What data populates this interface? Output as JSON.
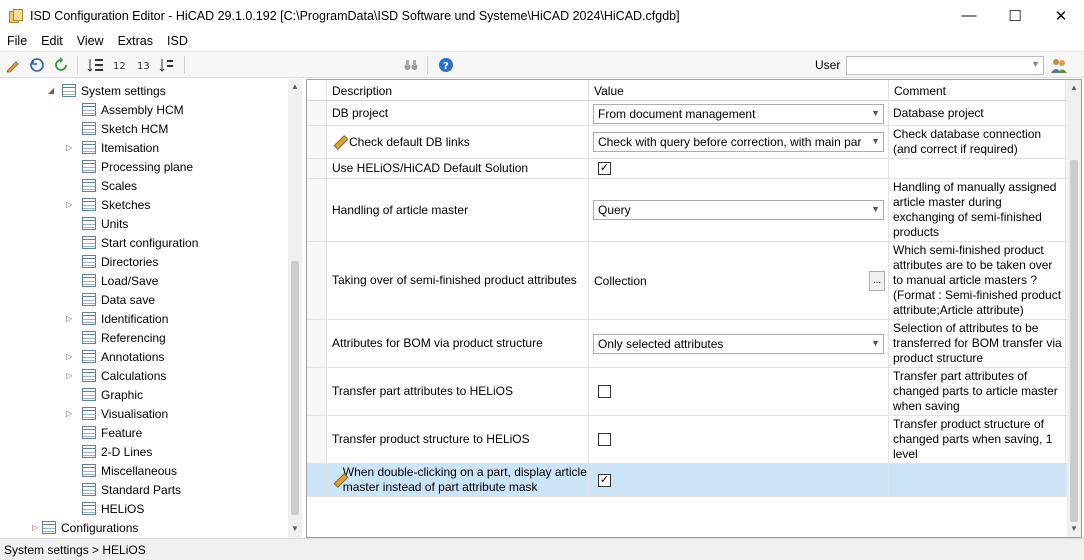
{
  "window": {
    "title": "ISD Configuration Editor  -  HiCAD 29.1.0.192 [C:\\ProgramData\\ISD Software und Systeme\\HiCAD 2024\\HiCAD.cfgdb]",
    "minimize": "—",
    "maximize": "☐",
    "close": "✕"
  },
  "menu": [
    "File",
    "Edit",
    "View",
    "Extras",
    "ISD"
  ],
  "toolbar": {
    "user_label": "User",
    "user_value": ""
  },
  "tree": {
    "root": "System settings",
    "items": [
      {
        "label": "Assembly HCM",
        "expandable": false
      },
      {
        "label": "Sketch HCM",
        "expandable": false
      },
      {
        "label": "Itemisation",
        "expandable": true
      },
      {
        "label": "Processing plane",
        "expandable": false
      },
      {
        "label": "Scales",
        "expandable": false
      },
      {
        "label": "Sketches",
        "expandable": true
      },
      {
        "label": "Units",
        "expandable": false
      },
      {
        "label": "Start configuration",
        "expandable": false
      },
      {
        "label": "Directories",
        "expandable": false
      },
      {
        "label": "Load/Save",
        "expandable": false
      },
      {
        "label": "Data save",
        "expandable": false
      },
      {
        "label": "Identification",
        "expandable": true
      },
      {
        "label": "Referencing",
        "expandable": false
      },
      {
        "label": "Annotations",
        "expandable": true
      },
      {
        "label": "Calculations",
        "expandable": true
      },
      {
        "label": "Graphic",
        "expandable": false
      },
      {
        "label": "Visualisation",
        "expandable": true
      },
      {
        "label": "Feature",
        "expandable": false
      },
      {
        "label": "2-D Lines",
        "expandable": false
      },
      {
        "label": "Miscellaneous",
        "expandable": false
      },
      {
        "label": "Standard Parts",
        "expandable": false
      },
      {
        "label": "HELiOS",
        "expandable": false
      }
    ],
    "configurations": "Configurations"
  },
  "grid": {
    "headers": {
      "description": "Description",
      "value": "Value",
      "comment": "Comment"
    },
    "rows": [
      {
        "description": "DB project",
        "value": "From document management",
        "value_type": "combo",
        "comment": "Database project",
        "pencil": false
      },
      {
        "description": "Check default DB links",
        "value": "Check with query before correction, with main par",
        "value_type": "combo",
        "comment": "Check database connection (and correct if required)",
        "pencil": true
      },
      {
        "description": "Use HELiOS/HiCAD Default Solution",
        "value": "checked",
        "value_type": "checkbox",
        "comment": "",
        "pencil": false
      },
      {
        "description": "Handling of article master",
        "value": "Query",
        "value_type": "combo",
        "comment": "Handling of manually assigned article master during exchanging of semi-finished products",
        "pencil": false
      },
      {
        "description": "Taking over of semi-finished product attributes",
        "value": "Collection",
        "value_type": "ellipsis",
        "comment": "Which semi-finished product attributes are to be taken over to manual article masters ? (Format : Semi-finished product attribute;Article attribute)",
        "pencil": false
      },
      {
        "description": "Attributes for BOM via product structure",
        "value": "Only selected attributes",
        "value_type": "combo",
        "comment": "Selection of attributes to be transferred for BOM transfer via product structure",
        "pencil": false
      },
      {
        "description": "Transfer part attributes to HELiOS",
        "value": "unchecked",
        "value_type": "checkbox",
        "comment": "Transfer part attributes of changed parts to article master when saving",
        "pencil": false
      },
      {
        "description": "Transfer product structure to HELiOS",
        "value": "unchecked",
        "value_type": "checkbox",
        "comment": "Transfer product structure of changed parts when saving, 1 level",
        "pencil": false
      },
      {
        "description": "When double-clicking on a part, display article master instead of part attribute mask",
        "value": "checked",
        "value_type": "checkbox",
        "comment": "",
        "pencil": true,
        "selected": true
      }
    ],
    "ellipsis": "...",
    "check_mark": "✓"
  },
  "status": {
    "breadcrumb": "System settings > HELiOS"
  },
  "colors": {
    "selection": "#cce4f7",
    "accent": "#0078d7"
  }
}
